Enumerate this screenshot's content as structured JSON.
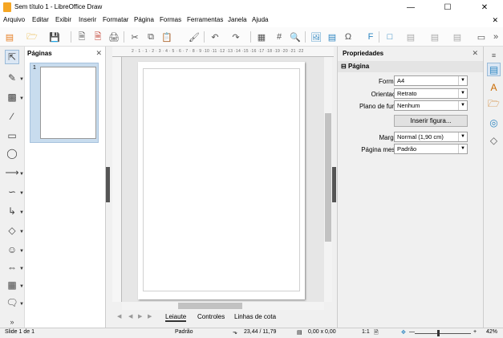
{
  "window": {
    "title": "Sem título 1 - LibreOffice Draw"
  },
  "menu": [
    "Arquivo",
    "Editar",
    "Exibir",
    "Inserir",
    "Formatar",
    "Página",
    "Formas",
    "Ferramentas",
    "Janela",
    "Ajuda"
  ],
  "pages_panel": {
    "title": "Páginas",
    "thumb_number": "1"
  },
  "properties": {
    "title": "Propriedades",
    "section": "Página",
    "format_label": "Formato:",
    "format_value": "A4",
    "orientation_label": "Orientação:",
    "orientation_value": "Retrato",
    "background_label": "Plano de fundo:",
    "background_value": "Nenhum",
    "insert_figure": "Inserir figura...",
    "margin_label": "Margem:",
    "margin_value": "Normal (1,90 cm)",
    "master_label": "Página mestre:",
    "master_value": "Padrão"
  },
  "ruler_text": "2 · 1 · 1 · 2 · 3 · 4 · 5 · 6 · 7 · 8 · 9 ·10 ·11 ·12 ·13 ·14 ·15 ·16 ·17 ·18 ·19 ·20 ·21 ·22",
  "tabs": [
    "Leiaute",
    "Controles",
    "Linhas de cota"
  ],
  "status": {
    "slide": "Slide 1 de 1",
    "master": "Padrão",
    "position": "23,44 / 11,79",
    "size": "0,00 x 0,00",
    "scale": "1:1",
    "zoom": "42%"
  }
}
